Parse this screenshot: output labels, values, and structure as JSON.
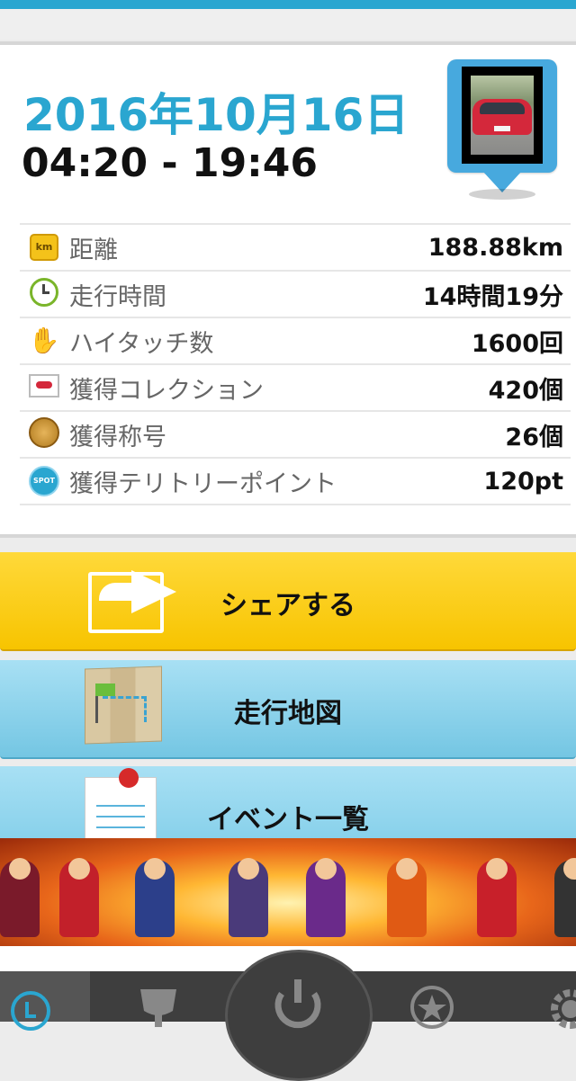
{
  "summary": {
    "date": "2016年10月16日",
    "time_range": "04:20 - 19:46"
  },
  "stats": [
    {
      "icon": "km-icon",
      "label": "距離",
      "value": "188.88km"
    },
    {
      "icon": "clock-icon",
      "label": "走行時間",
      "value": "14時間19分"
    },
    {
      "icon": "high-five-icon",
      "label": "ハイタッチ数",
      "value": "1600回"
    },
    {
      "icon": "car-card-icon",
      "label": "獲得コレクション",
      "value": "420個"
    },
    {
      "icon": "medal-icon",
      "label": "獲得称号",
      "value": "26個"
    },
    {
      "icon": "spot-icon",
      "label": "獲得テリトリーポイント",
      "value": "120pt"
    }
  ],
  "icon_text": {
    "km": "km",
    "spot": "SPOT",
    "high_five": "✋"
  },
  "actions": {
    "share_label": "シェアする",
    "map_label": "走行地図",
    "events_label": "イベント一覧"
  },
  "colors": {
    "accent_blue": "#2aa6d0",
    "share_yellow": "#f7c400",
    "action_light_blue": "#86d0ea"
  }
}
